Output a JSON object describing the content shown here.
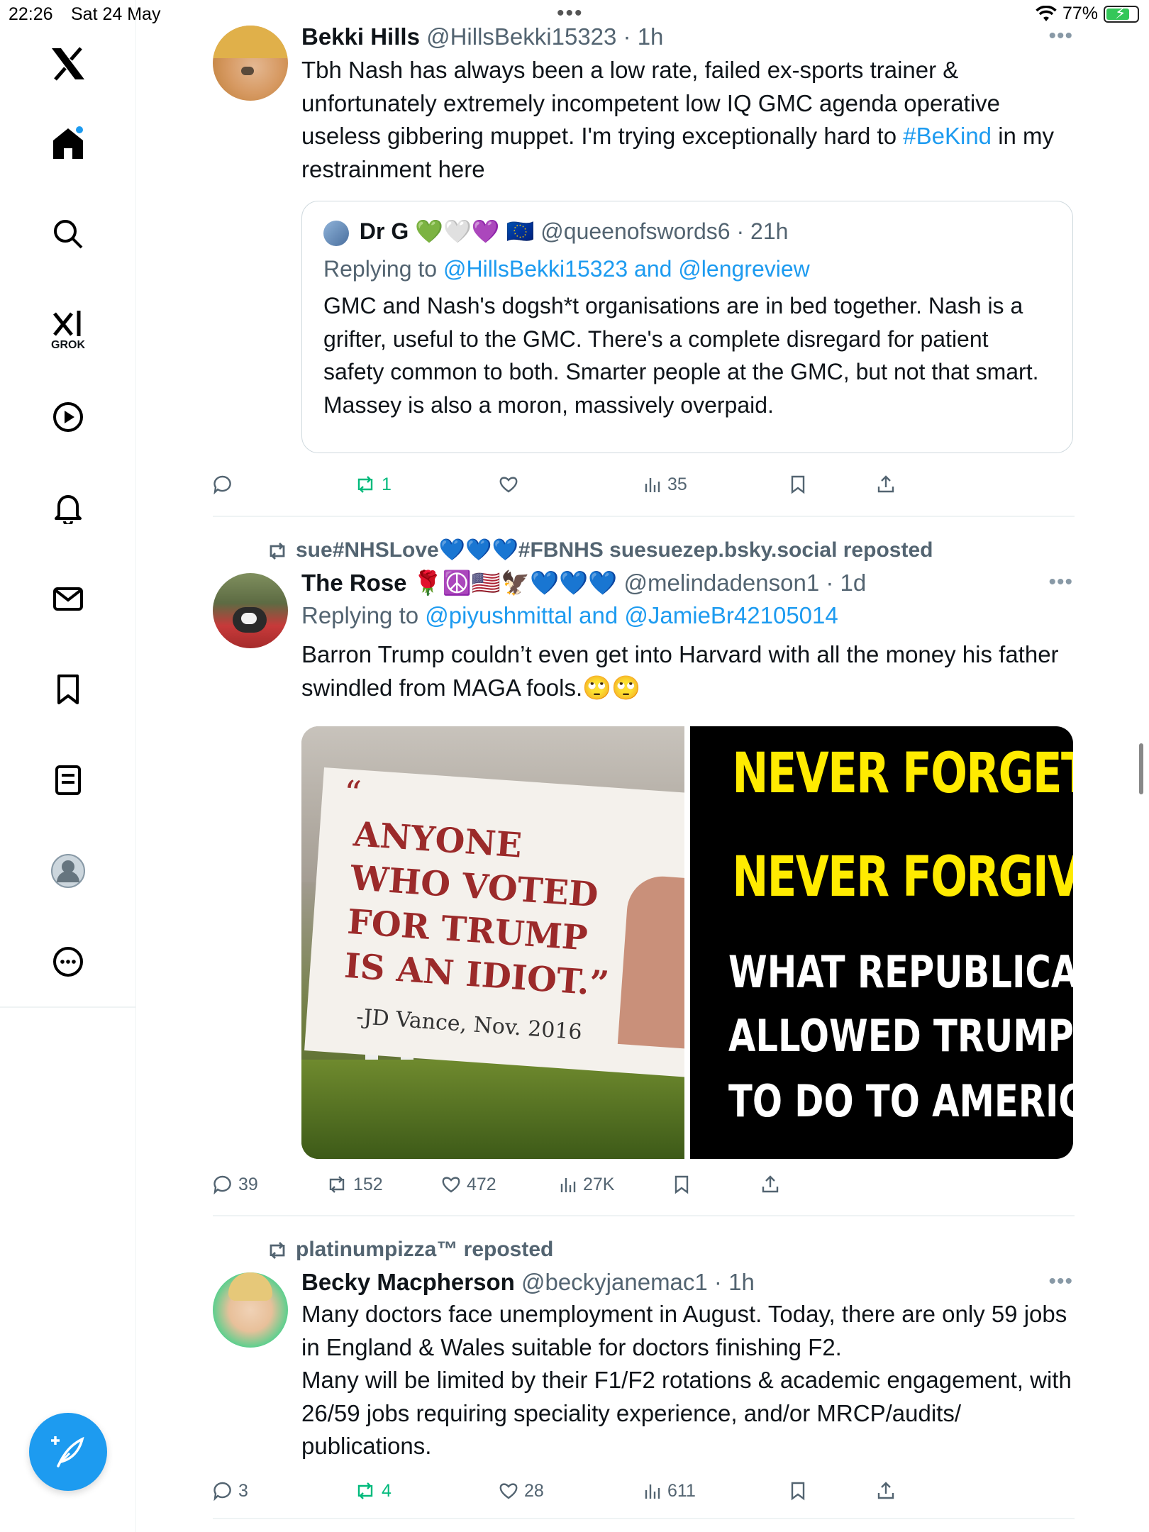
{
  "status_bar": {
    "time": "22:26",
    "date": "Sat 24 May",
    "battery": "77%"
  },
  "sidebar": {
    "items": [
      "home",
      "search",
      "grok",
      "video",
      "notifications",
      "messages",
      "bookmarks",
      "lists",
      "profile",
      "more"
    ],
    "grok_label": "GROK"
  },
  "tweets": [
    {
      "name": "Bekki Hills",
      "handle": "@HillsBekki15323 · 1h",
      "text_a": "Tbh Nash has always been a low rate, failed ex-sports trainer & unfortunately extremely incompetent low IQ GMC agenda operative useless gibbering muppet. I'm trying exceptionally hard to ",
      "hashtag": "#BeKind",
      "text_b": " in my restrainment here",
      "quote": {
        "name": "Dr G 💚🤍💜 🇪🇺",
        "handle": "@queenofswords6 · 21h",
        "reply_prefix": "Replying to ",
        "reply_targets": "@HillsBekki15323 and @lengreview",
        "text": "GMC and Nash's dogsh*t organisations are in bed together. Nash is a grifter, useful to the GMC. There's a complete disregard for patient safety common to both. Smarter people at the GMC, but not that smart. Massey is also a moron, massively overpaid."
      },
      "stats": {
        "replies": "",
        "reposts": "1",
        "likes": "",
        "views": "35"
      }
    },
    {
      "repost_by": "sue#NHSLove💙💙💙#FBNHS suesuezep.bsky.social reposted",
      "name": "The Rose 🌹☮️🇺🇸🦅💙💙💙",
      "handle": "@melindadenson1 · 1d",
      "reply_prefix": "Replying to ",
      "reply_targets": "@piyushmittal and @JamieBr42105014",
      "text": "Barron Trump couldn’t even get into Harvard with all the money his father swindled from MAGA fools.🙄🙄",
      "image_left": {
        "quote_mark": "“",
        "slogan": "ANYONE WHO VOTED FOR TRUMP IS AN IDIOT.”",
        "attribution": "-JD Vance, Nov. 2016"
      },
      "image_right": {
        "line1": "NEVER FORGET,",
        "line2": "NEVER FORGIVE",
        "line3": "WHAT REPUBLICANS",
        "line4": "ALLOWED TRUMP",
        "line5": "TO DO TO AMERICA."
      },
      "stats": {
        "replies": "39",
        "reposts": "152",
        "likes": "472",
        "views": "27K"
      }
    },
    {
      "repost_by": "platinumpizza™ reposted",
      "name": "Becky Macpherson",
      "handle": "@beckyjanemac1 · 1h",
      "text_a": "Many doctors face unemployment in August. Today, there are only 59 jobs in England & Wales suitable for doctors finishing F2.",
      "text_b": "Many will be limited by their F1/F2 rotations & academic engagement, with 26/59 jobs requiring speciality experience, and/or MRCP/audits/ publications.",
      "stats": {
        "replies": "3",
        "reposts": "4",
        "likes": "28",
        "views": "611"
      }
    }
  ],
  "colors": {
    "accent": "#1d9bf0",
    "repost_green": "#00ba7c",
    "muted": "#536471"
  }
}
